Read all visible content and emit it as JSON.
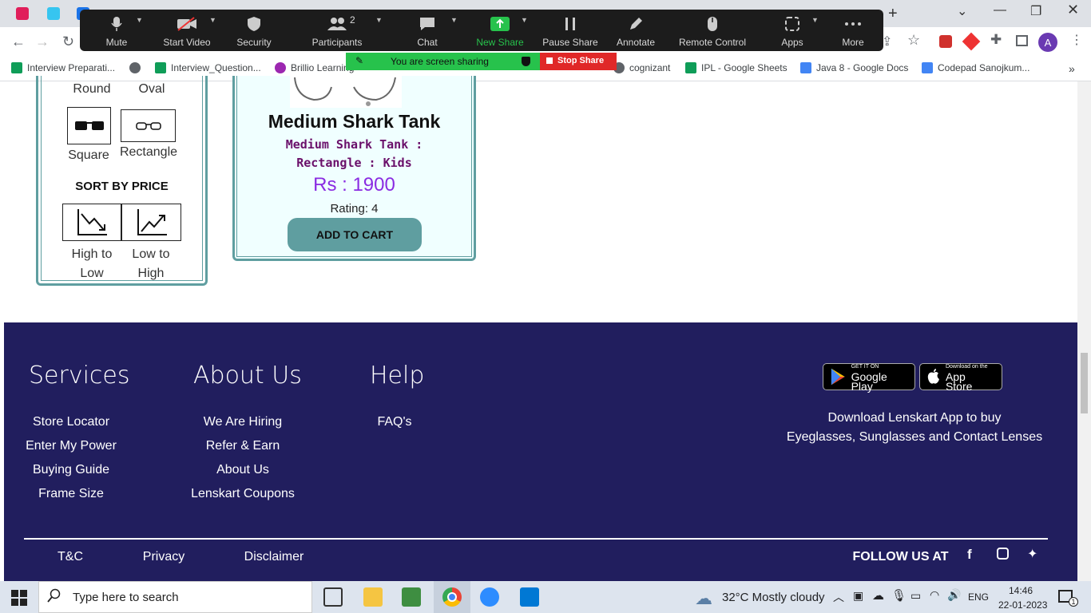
{
  "browser": {
    "bookmarks": [
      "Interview Preparati...",
      "Interview_Question...",
      "Brillio Learning",
      "cognizant",
      "IPL - Google Sheets",
      "Java 8 - Google Docs",
      "Codepad Sanojkum..."
    ],
    "profile_initial": "A"
  },
  "zoom": {
    "buttons": {
      "mute": "Mute",
      "start_video": "Start Video",
      "security": "Security",
      "participants": "Participants",
      "chat": "Chat",
      "new_share": "New Share",
      "pause_share": "Pause Share",
      "annotate": "Annotate",
      "remote_control": "Remote Control",
      "apps": "Apps",
      "more": "More"
    },
    "participants_count": "2",
    "sharing_status": "You are screen sharing",
    "stop_share": "Stop Share",
    "accent": "#27c24c"
  },
  "filters": {
    "shapes": [
      "Round",
      "Oval",
      "Square",
      "Rectangle"
    ],
    "sort_heading": "SORT BY PRICE",
    "sort_options": [
      "High to Low",
      "Low to High"
    ]
  },
  "product": {
    "name": "Medium Shark Tank",
    "details": "Medium Shark Tank : Rectangle : Kids",
    "price": "Rs : 1900",
    "rating": "Rating: 4",
    "add_to_cart": "ADD TO CART"
  },
  "footer": {
    "services": {
      "title": "Services",
      "links": [
        "Store Locator",
        "Enter My Power",
        "Buying Guide",
        "Frame Size"
      ]
    },
    "about": {
      "title": "About Us",
      "links": [
        "We Are Hiring",
        "Refer & Earn",
        "About Us",
        "Lenskart Coupons"
      ]
    },
    "help": {
      "title": "Help",
      "links": [
        "FAQ's"
      ]
    },
    "google_play": {
      "small": "GET IT ON",
      "big": "Google Play"
    },
    "app_store": {
      "small": "Download on the",
      "big": "App Store"
    },
    "app_text": "Download Lenskart App to buy\nEyeglasses, Sunglasses and Contact Lenses",
    "bottom_links": [
      "T&C",
      "Privacy",
      "Disclaimer"
    ],
    "follow": "FOLLOW US AT",
    "bg": "#211e5e"
  },
  "taskbar": {
    "search": "Type here to search",
    "weather": "32°C  Mostly cloudy",
    "lang": "ENG",
    "time": "14:46",
    "date": "22-01-2023",
    "notifications": "1"
  }
}
